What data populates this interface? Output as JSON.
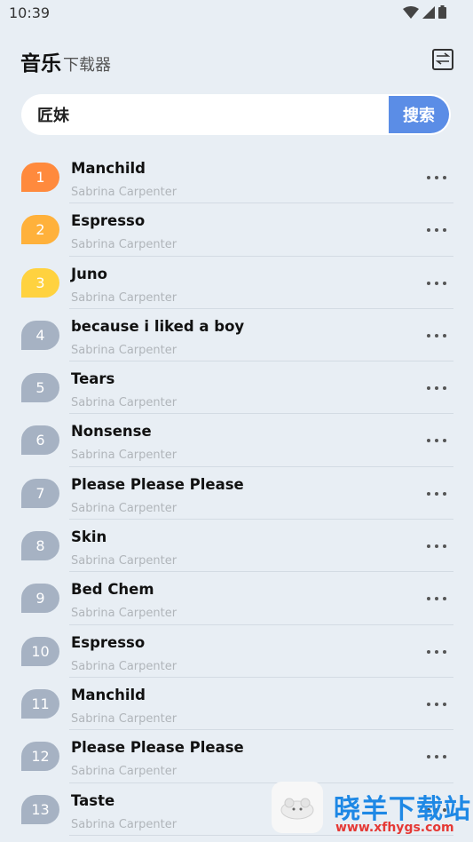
{
  "status_bar": {
    "time": "10:39"
  },
  "header": {
    "title": "音乐",
    "subtitle": "下载器"
  },
  "search": {
    "value": "匠妹",
    "button_label": "搜索"
  },
  "colors": {
    "rank1": "#ff8a3d",
    "rank2": "#ffb13b",
    "rank3": "#ffd23f",
    "rank_other": "#a6b2c3",
    "accent": "#5b8de6"
  },
  "songs": [
    {
      "rank": "1",
      "title": "Manchild",
      "artist": "Sabrina Carpenter"
    },
    {
      "rank": "2",
      "title": "Espresso",
      "artist": "Sabrina Carpenter"
    },
    {
      "rank": "3",
      "title": "Juno",
      "artist": "Sabrina Carpenter"
    },
    {
      "rank": "4",
      "title": "because i liked a boy",
      "artist": "Sabrina Carpenter"
    },
    {
      "rank": "5",
      "title": "Tears",
      "artist": "Sabrina Carpenter"
    },
    {
      "rank": "6",
      "title": "Nonsense",
      "artist": "Sabrina Carpenter"
    },
    {
      "rank": "7",
      "title": "Please Please Please",
      "artist": "Sabrina Carpenter"
    },
    {
      "rank": "8",
      "title": "Skin",
      "artist": "Sabrina Carpenter"
    },
    {
      "rank": "9",
      "title": "Bed Chem",
      "artist": "Sabrina Carpenter"
    },
    {
      "rank": "10",
      "title": "Espresso",
      "artist": "Sabrina Carpenter"
    },
    {
      "rank": "11",
      "title": "Manchild",
      "artist": "Sabrina Carpenter"
    },
    {
      "rank": "12",
      "title": "Please Please Please",
      "artist": "Sabrina Carpenter"
    },
    {
      "rank": "13",
      "title": "Taste",
      "artist": "Sabrina Carpenter"
    }
  ],
  "watermark": {
    "text": "晓羊下载站",
    "url": "www.xfhygs.com"
  }
}
